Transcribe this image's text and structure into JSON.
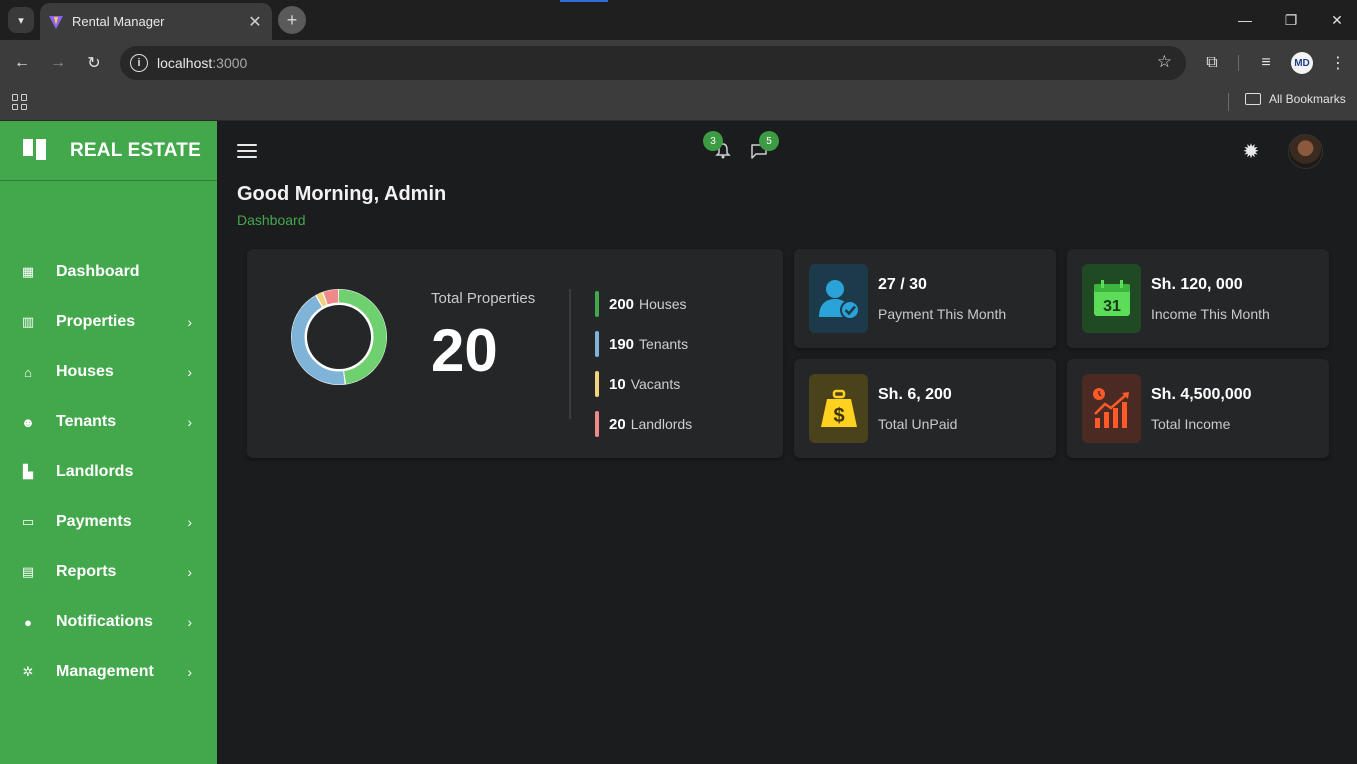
{
  "browser": {
    "tab_title": "Rental Manager",
    "url_host": "localhost",
    "url_port": ":3000",
    "bookmarks_label": "All Bookmarks",
    "profile_initials": "MD"
  },
  "sidebar": {
    "brand": "REAL ESTATE",
    "items": [
      {
        "label": "Dashboard",
        "icon": "dashboard-icon",
        "has_submenu": false
      },
      {
        "label": "Properties",
        "icon": "building-icon",
        "has_submenu": true
      },
      {
        "label": "Houses",
        "icon": "home-icon",
        "has_submenu": true
      },
      {
        "label": "Tenants",
        "icon": "users-icon",
        "has_submenu": true
      },
      {
        "label": "Landlords",
        "icon": "city-icon",
        "has_submenu": false
      },
      {
        "label": "Payments",
        "icon": "payment-card-icon",
        "has_submenu": true
      },
      {
        "label": "Reports",
        "icon": "report-icon",
        "has_submenu": true
      },
      {
        "label": "Notifications",
        "icon": "bell-icon",
        "has_submenu": true
      },
      {
        "label": "Management",
        "icon": "gear-icon",
        "has_submenu": true
      }
    ]
  },
  "header": {
    "notifications_count": "3",
    "messages_count": "5",
    "greeting": "Good Morning, Admin",
    "breadcrumb": "Dashboard"
  },
  "summary": {
    "total_label": "Total Properties",
    "total_value": "20",
    "stats": [
      {
        "value": "200",
        "label": "Houses",
        "color": "#43a84c"
      },
      {
        "value": "190",
        "label": "Tenants",
        "color": "#7fb3d8"
      },
      {
        "value": "10",
        "label": "Vacants",
        "color": "#f2d27a"
      },
      {
        "value": "20",
        "label": "Landlords",
        "color": "#f08a8a"
      }
    ],
    "donut": {
      "segments": [
        {
          "name": "Houses",
          "fraction": 0.48,
          "color": "#6fd06f"
        },
        {
          "name": "Tenants",
          "fraction": 0.44,
          "color": "#7fb3d8"
        },
        {
          "name": "Vacants",
          "fraction": 0.025,
          "color": "#f2d27a"
        },
        {
          "name": "Landlords",
          "fraction": 0.055,
          "color": "#f08a8a"
        }
      ]
    }
  },
  "kpis": [
    {
      "value": "27 / 30",
      "label": "Payment This Month",
      "icon": "user-check-icon",
      "bg": "#1d3a4a",
      "fg": "#2aa3d8"
    },
    {
      "value": "Sh. 120, 000",
      "label": "Income This Month",
      "icon": "calendar-icon",
      "bg": "#1f4a24",
      "fg": "#5ddc5a"
    },
    {
      "value": "Sh. 6, 200",
      "label": "Total UnPaid",
      "icon": "money-bag-icon",
      "bg": "#4a421a",
      "fg": "#ffd21f"
    },
    {
      "value": "Sh. 4,500,000",
      "label": "Total Income",
      "icon": "chart-growth-icon",
      "bg": "#4a2a22",
      "fg": "#ff5a28"
    }
  ]
}
